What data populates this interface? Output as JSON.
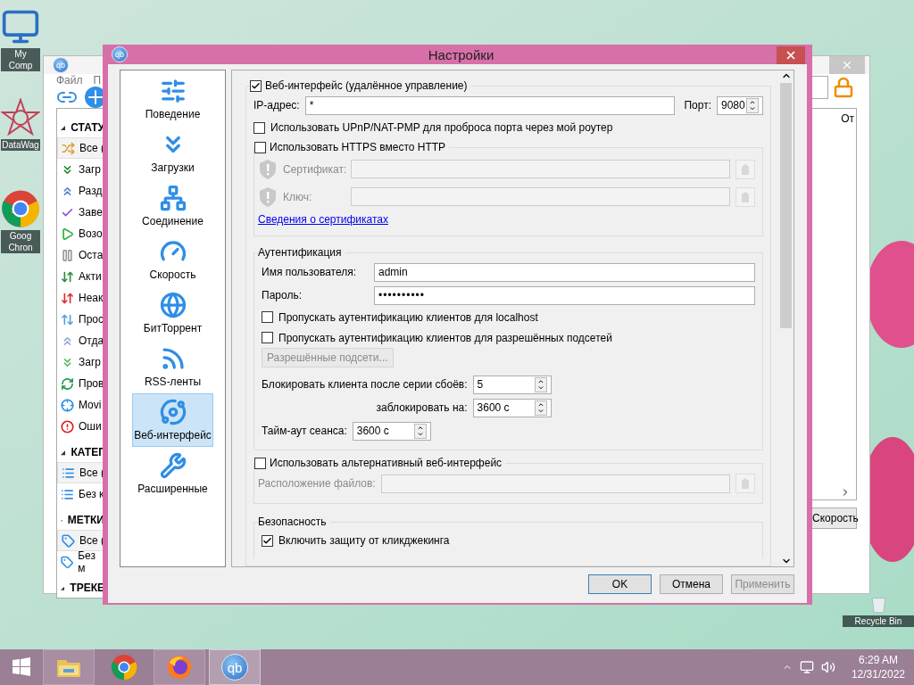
{
  "desktop_icons": [
    {
      "label": "My Comp",
      "kind": "computer"
    },
    {
      "label": "DataWag",
      "kind": "star"
    },
    {
      "label": "Goog Chron",
      "kind": "chrome"
    }
  ],
  "recycle_bin": {
    "label": "Recycle Bin"
  },
  "main_window": {
    "logo": "qb",
    "menu": [
      "Файл",
      "П"
    ],
    "sections": [
      {
        "title": "СТАТУ",
        "expanded": true,
        "items": [
          {
            "label": "Все (",
            "kind": "all",
            "selected": true
          },
          {
            "label": "Загр",
            "kind": "down",
            "selected": false
          },
          {
            "label": "Разд",
            "kind": "up",
            "selected": false
          },
          {
            "label": "Заве",
            "kind": "done",
            "selected": false
          },
          {
            "label": "Возо",
            "kind": "resumed",
            "selected": false
          },
          {
            "label": "Оста",
            "kind": "paused",
            "selected": false
          },
          {
            "label": "Акти",
            "kind": "active",
            "selected": false
          },
          {
            "label": "Неак",
            "kind": "inactive",
            "selected": false
          },
          {
            "label": "Прос",
            "kind": "stalled",
            "selected": false
          },
          {
            "label": "Отда",
            "kind": "stalled-up",
            "selected": false
          },
          {
            "label": "Загр",
            "kind": "stalled-down",
            "selected": false
          },
          {
            "label": "Пров",
            "kind": "checking",
            "selected": false
          },
          {
            "label": "Movi",
            "kind": "moving",
            "selected": false
          },
          {
            "label": "Оши",
            "kind": "error",
            "selected": false
          }
        ]
      },
      {
        "title": "КАТЕГ",
        "expanded": true,
        "items": [
          {
            "label": "Все (",
            "kind": "list",
            "selected": true
          },
          {
            "label": "Без к",
            "kind": "list",
            "selected": false
          }
        ]
      },
      {
        "title": "МЕТКИ",
        "expanded": true,
        "items": [
          {
            "label": "Все (",
            "kind": "tag",
            "selected": true
          },
          {
            "label": "Без м",
            "kind": "tag",
            "selected": false
          }
        ]
      },
      {
        "title": "ТРЕКЕ",
        "expanded": true
      }
    ],
    "column_header": "От",
    "speed_button": "Скорость"
  },
  "dialog": {
    "logo": "qb",
    "title": "Настройки",
    "nav": [
      {
        "label": "Поведение",
        "kind": "sliders",
        "selected": false
      },
      {
        "label": "Загрузки",
        "kind": "downloads",
        "selected": false
      },
      {
        "label": "Соединение",
        "kind": "network",
        "selected": false
      },
      {
        "label": "Скорость",
        "kind": "speed",
        "selected": false
      },
      {
        "label": "БитТоррент",
        "kind": "globe",
        "selected": false
      },
      {
        "label": "RSS-ленты",
        "kind": "rss",
        "selected": false
      },
      {
        "label": "Веб-интерфейс",
        "kind": "planet",
        "selected": true
      },
      {
        "label": "Расширенные",
        "kind": "tools",
        "selected": false
      }
    ],
    "web_ui": {
      "label": "Веб-интерфейс (удалённое управление)",
      "checked": true,
      "ip_label": "IP-адрес:",
      "ip_value": "*",
      "port_label": "Порт:",
      "port_value": "9080",
      "upnp": {
        "label": "Использовать UPnP/NAT-PMP для проброса порта через мой роутер",
        "checked": false
      },
      "https": {
        "label": "Использовать HTTPS вместо HTTP",
        "checked": false,
        "certificate_label": "Сертификат:",
        "key_label": "Ключ:",
        "link": "Сведения о сертификатах"
      },
      "auth": {
        "title": "Аутентификация",
        "username_label": "Имя пользователя:",
        "username": "admin",
        "password_label": "Пароль:",
        "password": "••••••••••",
        "options": [
          {
            "label": "Пропускать аутентификацию клиентов для localhost",
            "checked": false
          },
          {
            "label": "Пропускать аутентификацию клиентов для разрешённых подсетей",
            "checked": false
          }
        ],
        "subnets_button": "Разрешённые подсети...",
        "ban_label": "Блокировать клиента после серии сбоёв:",
        "ban_value": "5",
        "ban_time_label": "заблокировать на:",
        "ban_time_value": "3600 с",
        "timeout_label": "Тайм-аут сеанса:",
        "timeout_value": "3600 с"
      },
      "alt_ui": {
        "label": "Использовать альтернативный веб-интерфейс",
        "checked": false,
        "location_label": "Расположение файлов:"
      },
      "security": {
        "title": "Безопасность",
        "options": [
          {
            "label": "Включить защиту от кликджекинга",
            "checked": true
          }
        ]
      }
    },
    "buttons": [
      {
        "label": "OK",
        "default": true,
        "disabled": false
      },
      {
        "label": "Отмена",
        "default": false,
        "disabled": false
      },
      {
        "label": "Применить",
        "default": false,
        "disabled": true
      }
    ]
  },
  "taskbar": {
    "apps": [
      {
        "kind": "explorer",
        "running": true,
        "active": false
      },
      {
        "kind": "chrome",
        "running": false,
        "active": false
      },
      {
        "kind": "firefox",
        "running": true,
        "active": false
      },
      {
        "kind": "qbittorrent",
        "logo": "qb",
        "running": true,
        "active": true
      }
    ],
    "time": "6:29 AM",
    "date": "12/31/2022"
  }
}
